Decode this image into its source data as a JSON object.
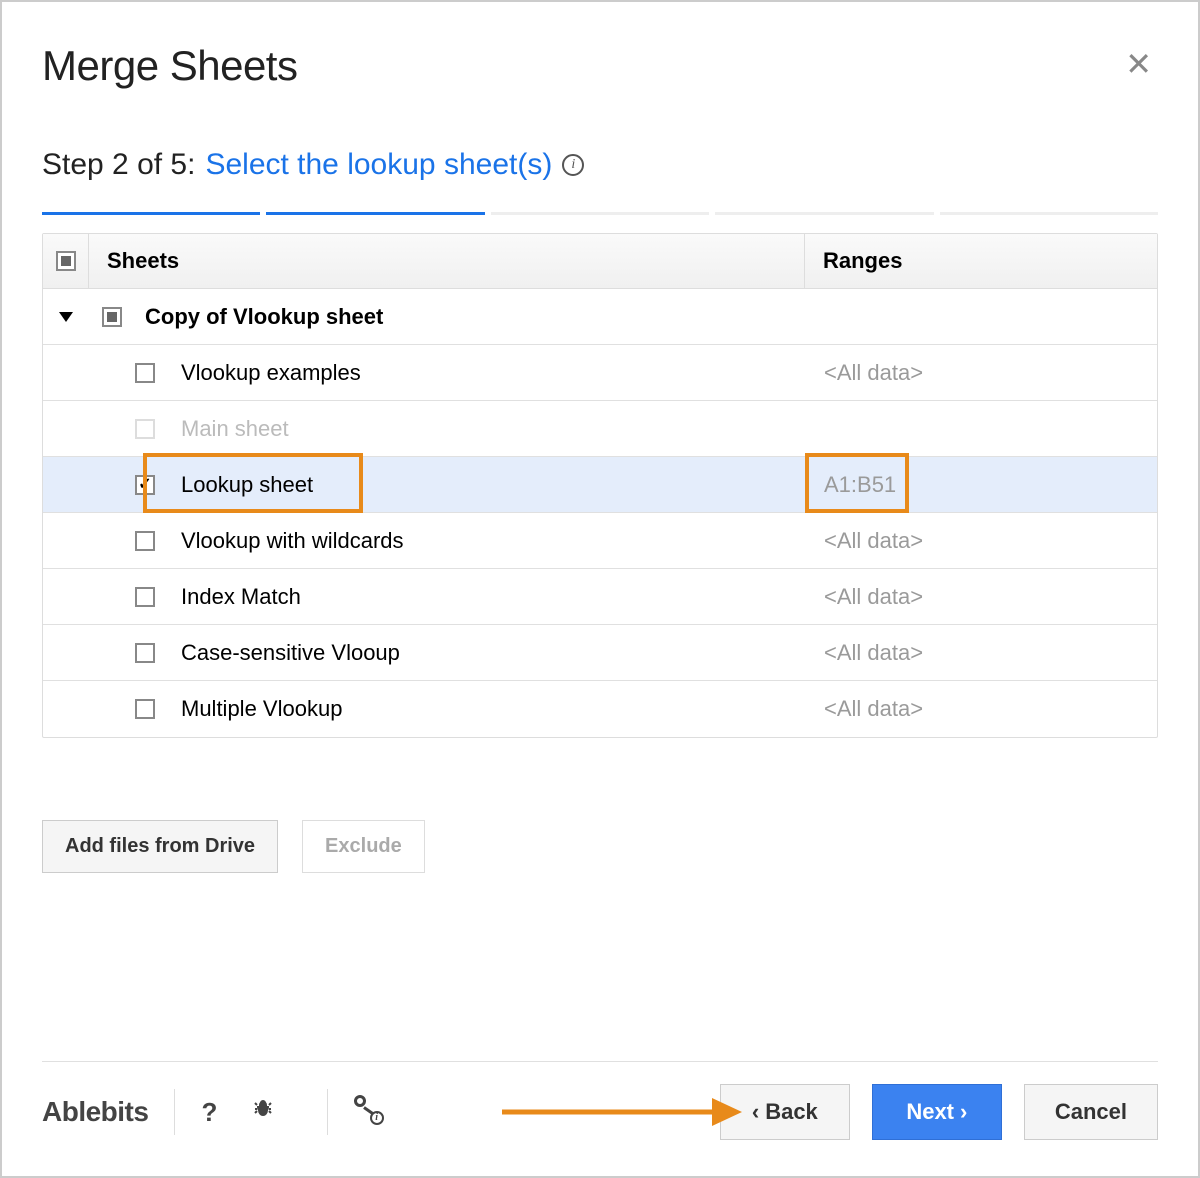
{
  "title": "Merge Sheets",
  "step": {
    "prefix": "Step 2 of 5:",
    "label": "Select the lookup sheet(s)"
  },
  "progress_total": 5,
  "progress_done": 2,
  "columns": {
    "sheets": "Sheets",
    "ranges": "Ranges"
  },
  "group": {
    "name": "Copy of Vlookup sheet"
  },
  "rows": [
    {
      "name": "Vlookup examples",
      "range": "<All data>",
      "checked": false,
      "disabled": false,
      "selected": false
    },
    {
      "name": "Main sheet",
      "range": "",
      "checked": false,
      "disabled": true,
      "selected": false
    },
    {
      "name": "Lookup sheet",
      "range": "A1:B51",
      "checked": true,
      "disabled": false,
      "selected": true
    },
    {
      "name": "Vlookup with wildcards",
      "range": "<All data>",
      "checked": false,
      "disabled": false,
      "selected": false
    },
    {
      "name": "Index Match",
      "range": "<All data>",
      "checked": false,
      "disabled": false,
      "selected": false
    },
    {
      "name": "Case-sensitive Vlooup",
      "range": "<All data>",
      "checked": false,
      "disabled": false,
      "selected": false
    },
    {
      "name": "Multiple Vlookup",
      "range": "<All data>",
      "checked": false,
      "disabled": false,
      "selected": false
    }
  ],
  "buttons": {
    "add_drive": "Add files from Drive",
    "exclude": "Exclude",
    "back": "Back",
    "next": "Next",
    "cancel": "Cancel"
  },
  "brand": "Ablebits",
  "icons": {
    "help": "?",
    "bug": "🐞"
  }
}
